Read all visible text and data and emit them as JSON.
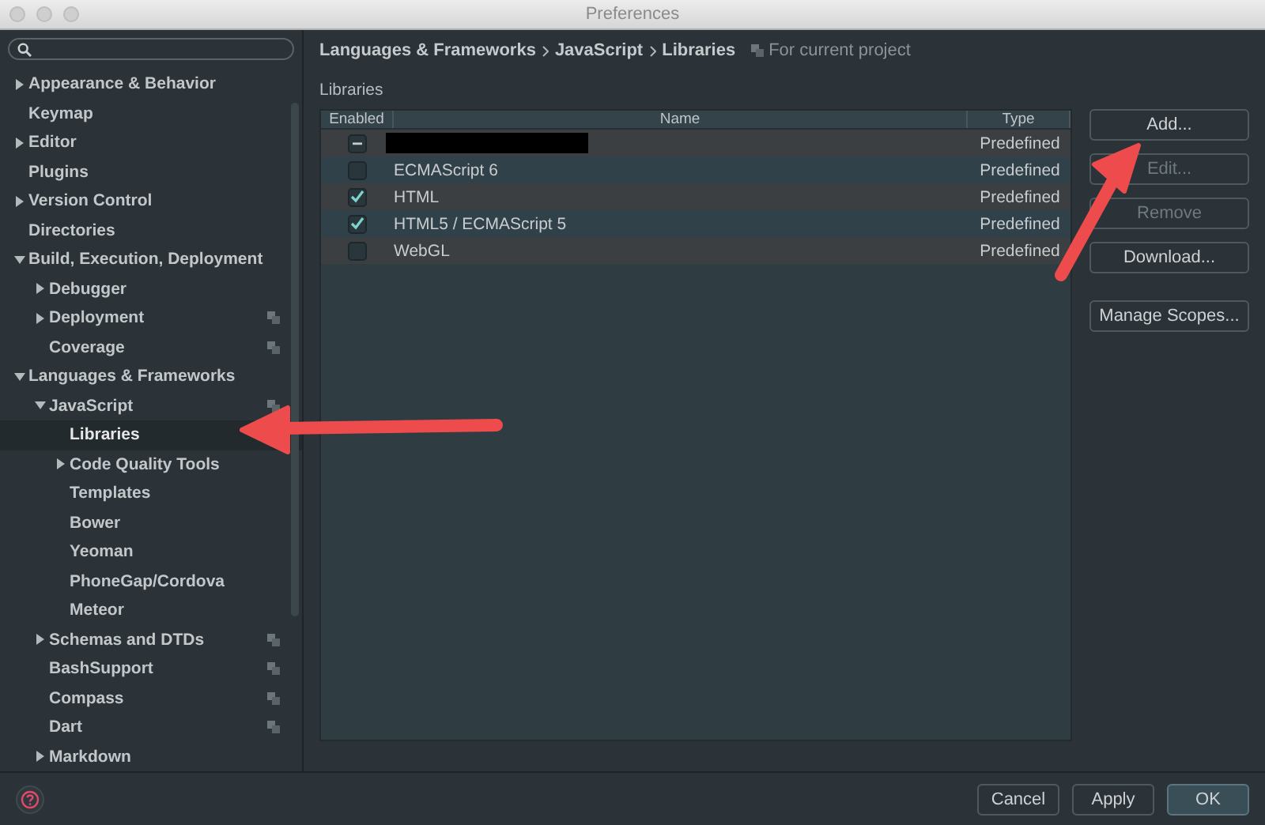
{
  "window": {
    "title": "Preferences"
  },
  "sidebar": {
    "items": [
      {
        "label": "Appearance & Behavior",
        "expanded": false,
        "selected": false,
        "project": false,
        "has_children": true
      },
      {
        "label": "Keymap",
        "selected": false,
        "project": false,
        "has_children": false
      },
      {
        "label": "Editor",
        "expanded": false,
        "selected": false,
        "project": false,
        "has_children": true
      },
      {
        "label": "Plugins",
        "selected": false,
        "project": false,
        "has_children": false
      },
      {
        "label": "Version Control",
        "expanded": false,
        "selected": false,
        "project": false,
        "has_children": true
      },
      {
        "label": "Directories",
        "selected": false,
        "project": false,
        "has_children": false
      },
      {
        "label": "Build, Execution, Deployment",
        "expanded": true,
        "selected": false,
        "project": false,
        "has_children": true,
        "children": [
          {
            "label": "Debugger",
            "expanded": false,
            "selected": false,
            "project": false,
            "has_children": true
          },
          {
            "label": "Deployment",
            "expanded": false,
            "selected": false,
            "project": true,
            "has_children": true
          },
          {
            "label": "Coverage",
            "selected": false,
            "project": true,
            "has_children": false
          }
        ]
      },
      {
        "label": "Languages & Frameworks",
        "expanded": true,
        "selected": false,
        "project": false,
        "has_children": true,
        "children": [
          {
            "label": "JavaScript",
            "expanded": true,
            "selected": false,
            "project": true,
            "has_children": true,
            "children": [
              {
                "label": "Libraries",
                "selected": true,
                "project": false,
                "has_children": false
              },
              {
                "label": "Code Quality Tools",
                "expanded": false,
                "selected": false,
                "project": false,
                "has_children": true
              },
              {
                "label": "Templates",
                "selected": false,
                "project": false,
                "has_children": false
              },
              {
                "label": "Bower",
                "selected": false,
                "project": false,
                "has_children": false
              },
              {
                "label": "Yeoman",
                "selected": false,
                "project": false,
                "has_children": false
              },
              {
                "label": "PhoneGap/Cordova",
                "selected": false,
                "project": false,
                "has_children": false
              },
              {
                "label": "Meteor",
                "selected": false,
                "project": false,
                "has_children": false
              }
            ]
          },
          {
            "label": "Schemas and DTDs",
            "expanded": false,
            "selected": false,
            "project": true,
            "has_children": true
          },
          {
            "label": "BashSupport",
            "selected": false,
            "project": true,
            "has_children": false
          },
          {
            "label": "Compass",
            "selected": false,
            "project": true,
            "has_children": false
          },
          {
            "label": "Dart",
            "selected": false,
            "project": true,
            "has_children": false
          },
          {
            "label": "Markdown",
            "expanded": false,
            "selected": false,
            "project": false,
            "has_children": true
          }
        ]
      }
    ]
  },
  "breadcrumb": [
    "Languages & Frameworks",
    "JavaScript",
    "Libraries"
  ],
  "scope_note": "For current project",
  "section_title": "Libraries",
  "table": {
    "columns": [
      "Enabled",
      "Name",
      "Type"
    ],
    "rows": [
      {
        "kind": "redacted",
        "checked": false,
        "indeterminate": true,
        "type": "Predefined"
      },
      {
        "kind": "text",
        "checked": false,
        "indeterminate": false,
        "name": "ECMAScript 6",
        "type": "Predefined"
      },
      {
        "kind": "text",
        "checked": true,
        "indeterminate": false,
        "name": "HTML",
        "type": "Predefined"
      },
      {
        "kind": "text",
        "checked": true,
        "indeterminate": false,
        "name": "HTML5 / ECMAScript 5",
        "type": "Predefined"
      },
      {
        "kind": "text",
        "checked": false,
        "indeterminate": false,
        "name": "WebGL",
        "type": "Predefined"
      }
    ]
  },
  "actions": [
    {
      "label": "Add...",
      "disabled": false
    },
    {
      "label": "Edit...",
      "disabled": true
    },
    {
      "label": "Remove",
      "disabled": true
    },
    {
      "label": "Download...",
      "disabled": false
    },
    {
      "label": "Manage Scopes...",
      "disabled": false
    }
  ],
  "footer": {
    "buttons": [
      {
        "label": "Cancel",
        "default": false
      },
      {
        "label": "Apply",
        "default": false
      },
      {
        "label": "OK",
        "default": true
      }
    ]
  }
}
